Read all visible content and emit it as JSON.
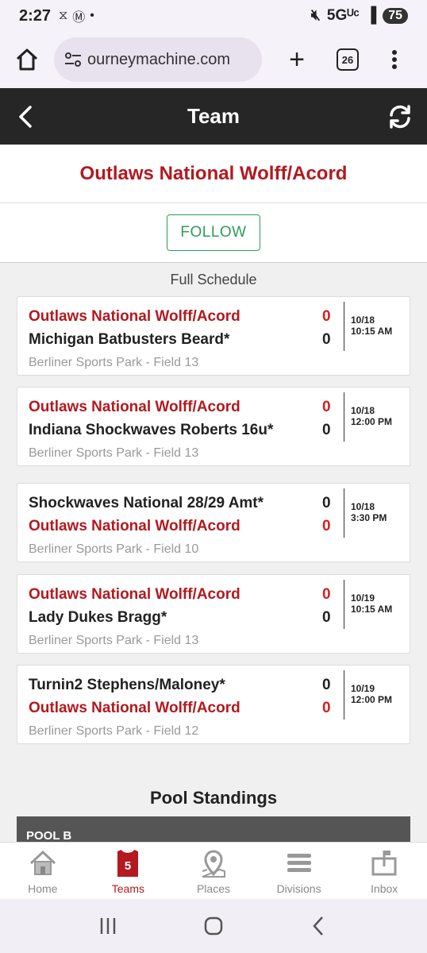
{
  "status": {
    "time": "2:27",
    "network": "5Gᵁᶜ",
    "battery": "75"
  },
  "browser": {
    "url": "ourneymachine.com",
    "tab_count": "26"
  },
  "header": {
    "title": "Team"
  },
  "team": {
    "name": "Outlaws National Wolff/Acord",
    "follow_label": "FOLLOW"
  },
  "schedule": {
    "title": "Full Schedule",
    "games": [
      {
        "team1": "Outlaws National Wolff/Acord",
        "score1": "0",
        "team1_home": true,
        "team2": "Michigan Batbusters Beard*",
        "score2": "0",
        "team2_home": false,
        "date": "10/18",
        "time": "10:15 AM",
        "venue": "Berliner Sports Park - Field 13"
      },
      {
        "team1": "Outlaws National Wolff/Acord",
        "score1": "0",
        "team1_home": true,
        "team2": "Indiana Shockwaves Roberts 16u*",
        "score2": "0",
        "team2_home": false,
        "date": "10/18",
        "time": "12:00 PM",
        "venue": "Berliner Sports Park - Field 13"
      },
      {
        "team1": "Shockwaves National 28/29 Amt*",
        "score1": "0",
        "team1_home": false,
        "team2": "Outlaws National Wolff/Acord",
        "score2": "0",
        "team2_home": true,
        "date": "10/18",
        "time": "3:30 PM",
        "venue": "Berliner Sports Park - Field 10"
      },
      {
        "team1": "Outlaws National Wolff/Acord",
        "score1": "0",
        "team1_home": true,
        "team2": "Lady Dukes Bragg*",
        "score2": "0",
        "team2_home": false,
        "date": "10/19",
        "time": "10:15 AM",
        "venue": "Berliner Sports Park - Field 13"
      },
      {
        "team1": "Turnin2 Stephens/Maloney*",
        "score1": "0",
        "team1_home": false,
        "team2": "Outlaws National Wolff/Acord",
        "score2": "0",
        "team2_home": true,
        "date": "10/19",
        "time": "12:00 PM",
        "venue": "Berliner Sports Park - Field 12"
      }
    ]
  },
  "pool": {
    "heading": "Pool Standings",
    "name": "POOL B"
  },
  "nav": {
    "items": [
      {
        "label": "Home",
        "icon": "home-icon"
      },
      {
        "label": "Teams",
        "icon": "jersey-icon",
        "badge": "5"
      },
      {
        "label": "Places",
        "icon": "map-pin-icon"
      },
      {
        "label": "Divisions",
        "icon": "list-icon"
      },
      {
        "label": "Inbox",
        "icon": "inbox-icon"
      }
    ]
  },
  "colors": {
    "accent": "#b3191f",
    "follow": "#2e9c5a",
    "header_bg": "#262626"
  }
}
